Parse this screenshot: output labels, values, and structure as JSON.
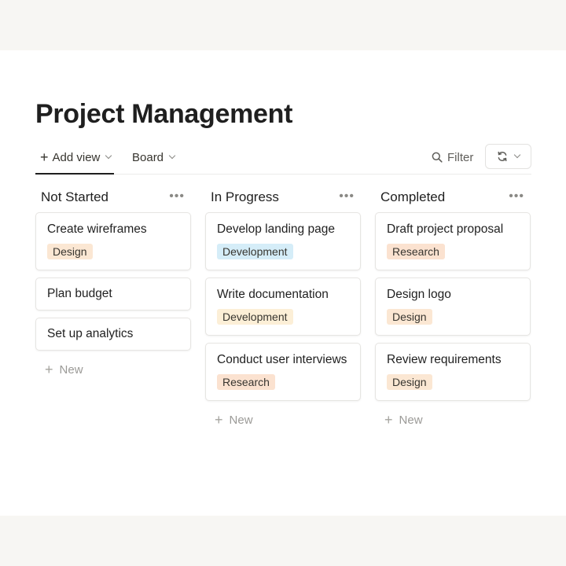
{
  "page": {
    "title": "Project Management"
  },
  "toolbar": {
    "add_view_label": "Add view",
    "board_label": "Board",
    "filter_label": "Filter"
  },
  "columns": [
    {
      "title": "Not Started",
      "cards": [
        {
          "title": "Create wireframes",
          "tag": "Design"
        },
        {
          "title": "Plan budget"
        },
        {
          "title": "Set up analytics"
        }
      ],
      "new_label": "New"
    },
    {
      "title": "In Progress",
      "cards": [
        {
          "title": "Develop landing page",
          "tag": "Development"
        },
        {
          "title": "Write documentation",
          "tag": "Development"
        },
        {
          "title": "Conduct user interviews",
          "tag": "Research"
        }
      ],
      "new_label": "New"
    },
    {
      "title": "Completed",
      "cards": [
        {
          "title": "Draft project proposal",
          "tag": "Research"
        },
        {
          "title": "Design logo",
          "tag": "Design"
        },
        {
          "title": "Review requirements",
          "tag": "Design"
        }
      ],
      "new_label": "New"
    }
  ],
  "colors": {
    "tag_design": "#fbe7d3",
    "tag_research": "#fbe2d0",
    "tag_development": "#d5edf8",
    "tag_development_alt": "#fcefd7"
  },
  "icons": {
    "add": "plus-icon",
    "dropdown": "chevron-down-icon",
    "filter": "search-icon",
    "sync": "sync-icon",
    "more": "more-icon"
  }
}
